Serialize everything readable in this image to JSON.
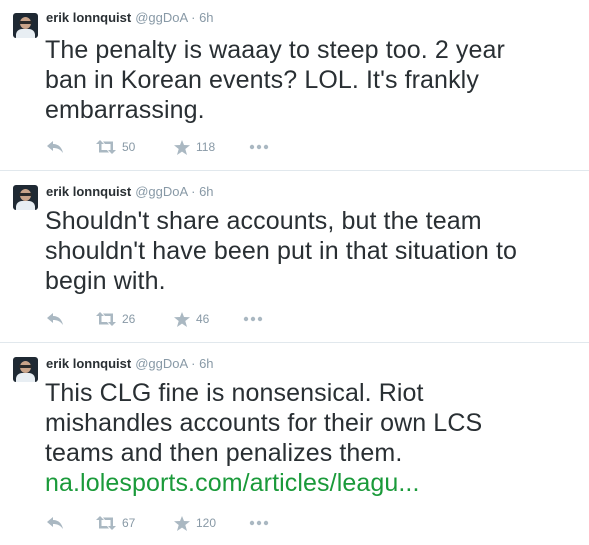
{
  "tweets": [
    {
      "name": "erik lonnquist",
      "handle": "@ggDoA",
      "separator": "·",
      "time": "6h",
      "text_lines": [
        "The penalty is waaay to steep too. 2 year",
        "ban in Korean events? LOL. It's frankly",
        "embarrassing."
      ],
      "link": "",
      "retweets": "50",
      "favorites": "118"
    },
    {
      "name": "erik lonnquist",
      "handle": "@ggDoA",
      "separator": "·",
      "time": "6h",
      "text_lines": [
        "Shouldn't share accounts, but the team",
        "shouldn't have been put in that situation to",
        "begin with."
      ],
      "link": "",
      "retweets": "26",
      "favorites": "46"
    },
    {
      "name": "erik lonnquist",
      "handle": "@ggDoA",
      "separator": "·",
      "time": "6h",
      "text_lines": [
        "This CLG fine is nonsensical. Riot",
        "mishandles accounts for their own LCS",
        "teams and then penalizes them."
      ],
      "link": "na.lolesports.com/articles/leagu...",
      "retweets": "67",
      "favorites": "120"
    }
  ],
  "icons": {
    "reply": "reply-icon",
    "retweet": "retweet-icon",
    "favorite": "star-icon",
    "more": "more-icon"
  },
  "colors": {
    "text": "#292f33",
    "secondary": "#8899a6",
    "icon": "#aab8c2",
    "link": "#1a9a3a",
    "divider": "#e1e8ed"
  }
}
